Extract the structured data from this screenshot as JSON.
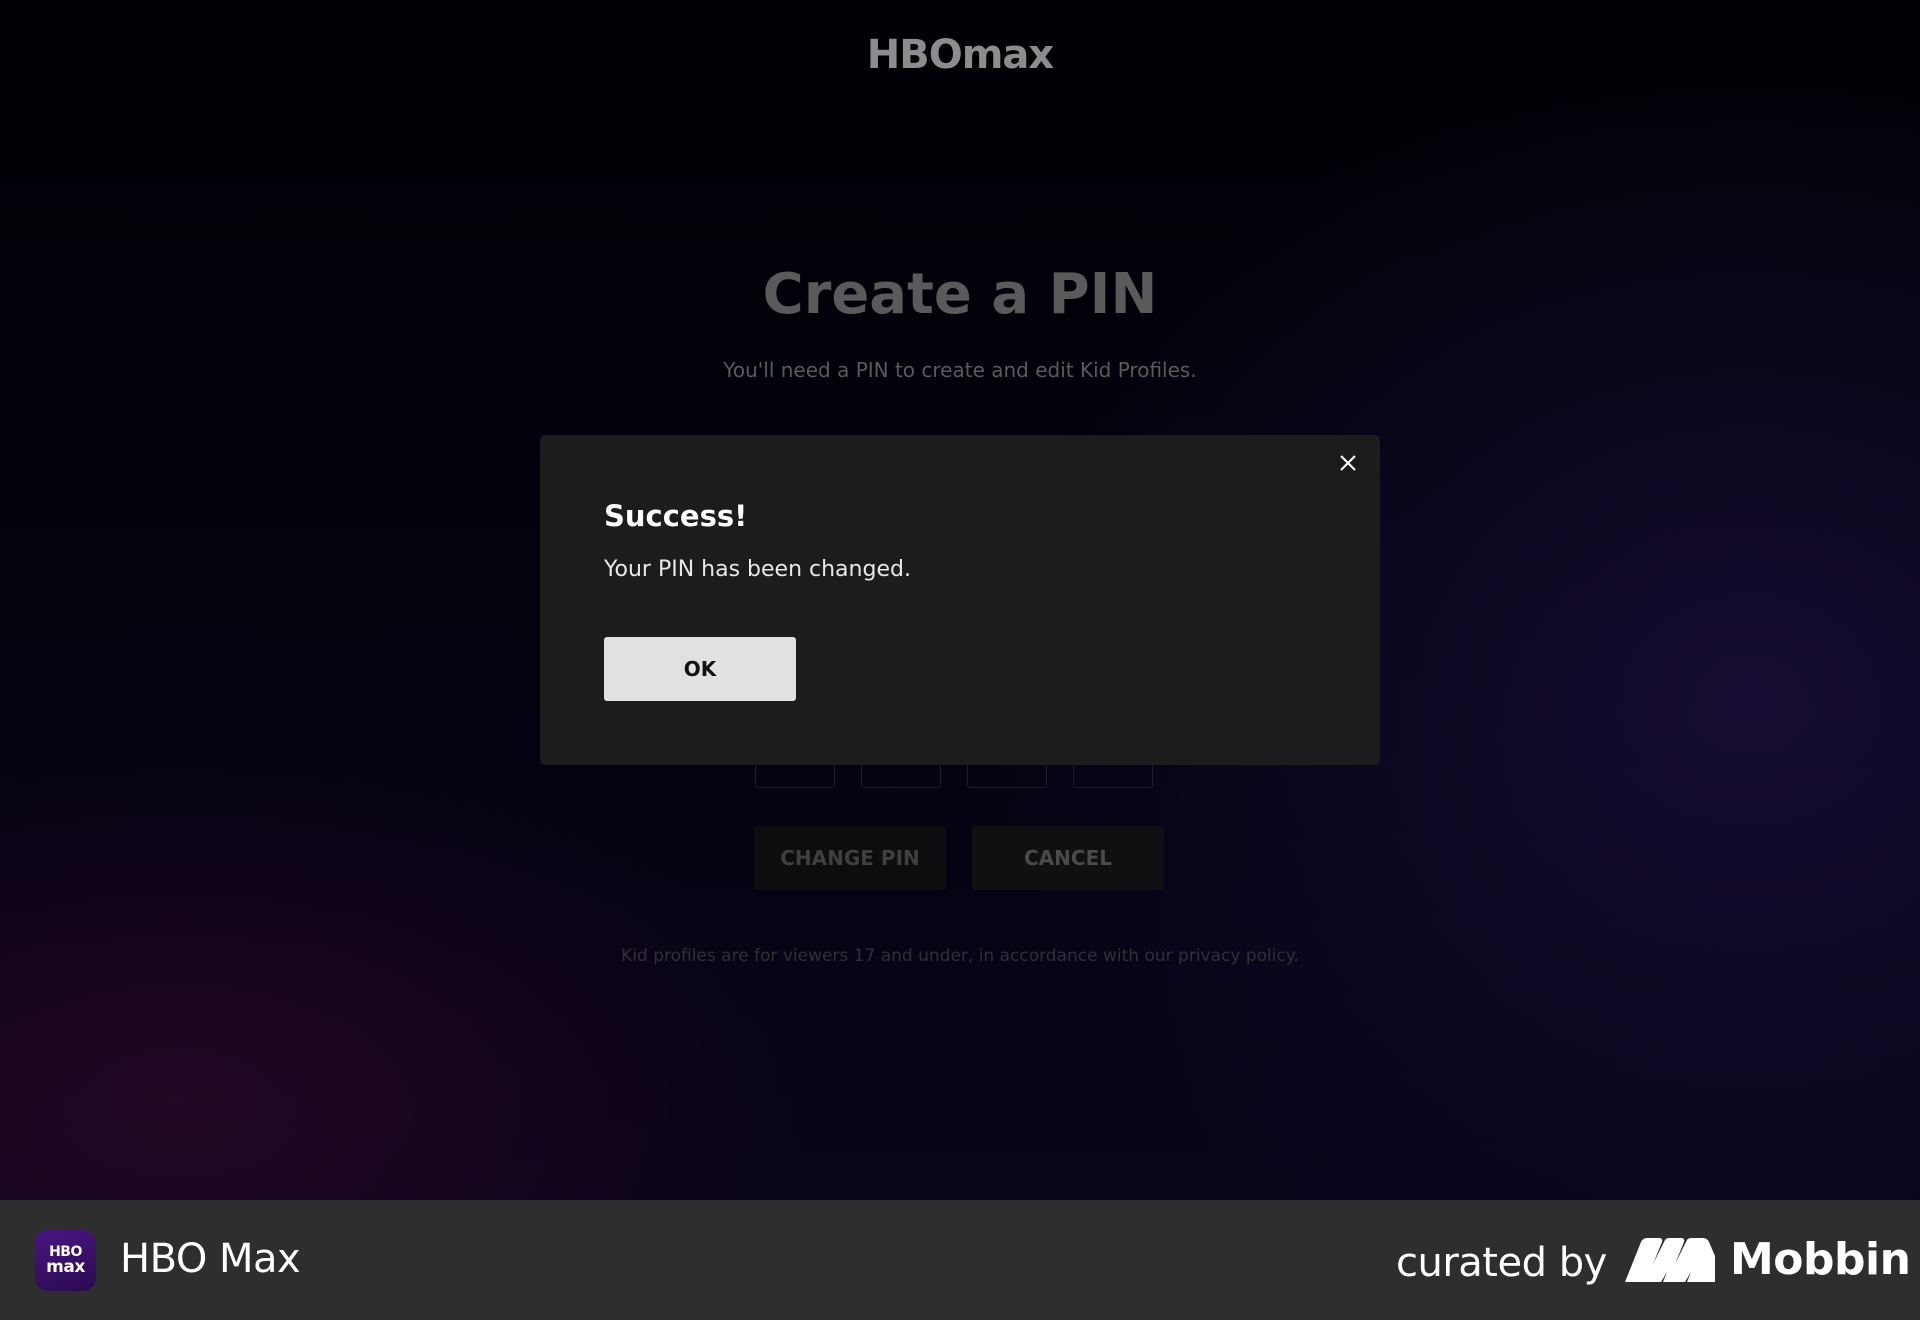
{
  "header": {
    "logo_text": "HBOmax"
  },
  "background": {
    "title": "Create a PIN",
    "subtitle": "You'll need a PIN to create and edit Kid Profiles.",
    "change_pin_label": "CHANGE PIN",
    "cancel_label": "CANCEL",
    "footnote": "Kid profiles are for viewers 17 and under, in accordance with our privacy policy."
  },
  "modal": {
    "title": "Success!",
    "message": "Your PIN has been changed.",
    "ok_label": "OK",
    "close_icon": "close-icon"
  },
  "footer": {
    "app_icon_line1": "HBO",
    "app_icon_line2": "max",
    "app_name": "HBO Max",
    "curated_by": "curated by",
    "brand": "Mobbin"
  },
  "colors": {
    "modal_bg": "#1c1c1c",
    "ok_button_bg": "#e1e1e1",
    "footer_bg": "#2e2e2e",
    "app_icon_bg": "#3a0f6b"
  }
}
